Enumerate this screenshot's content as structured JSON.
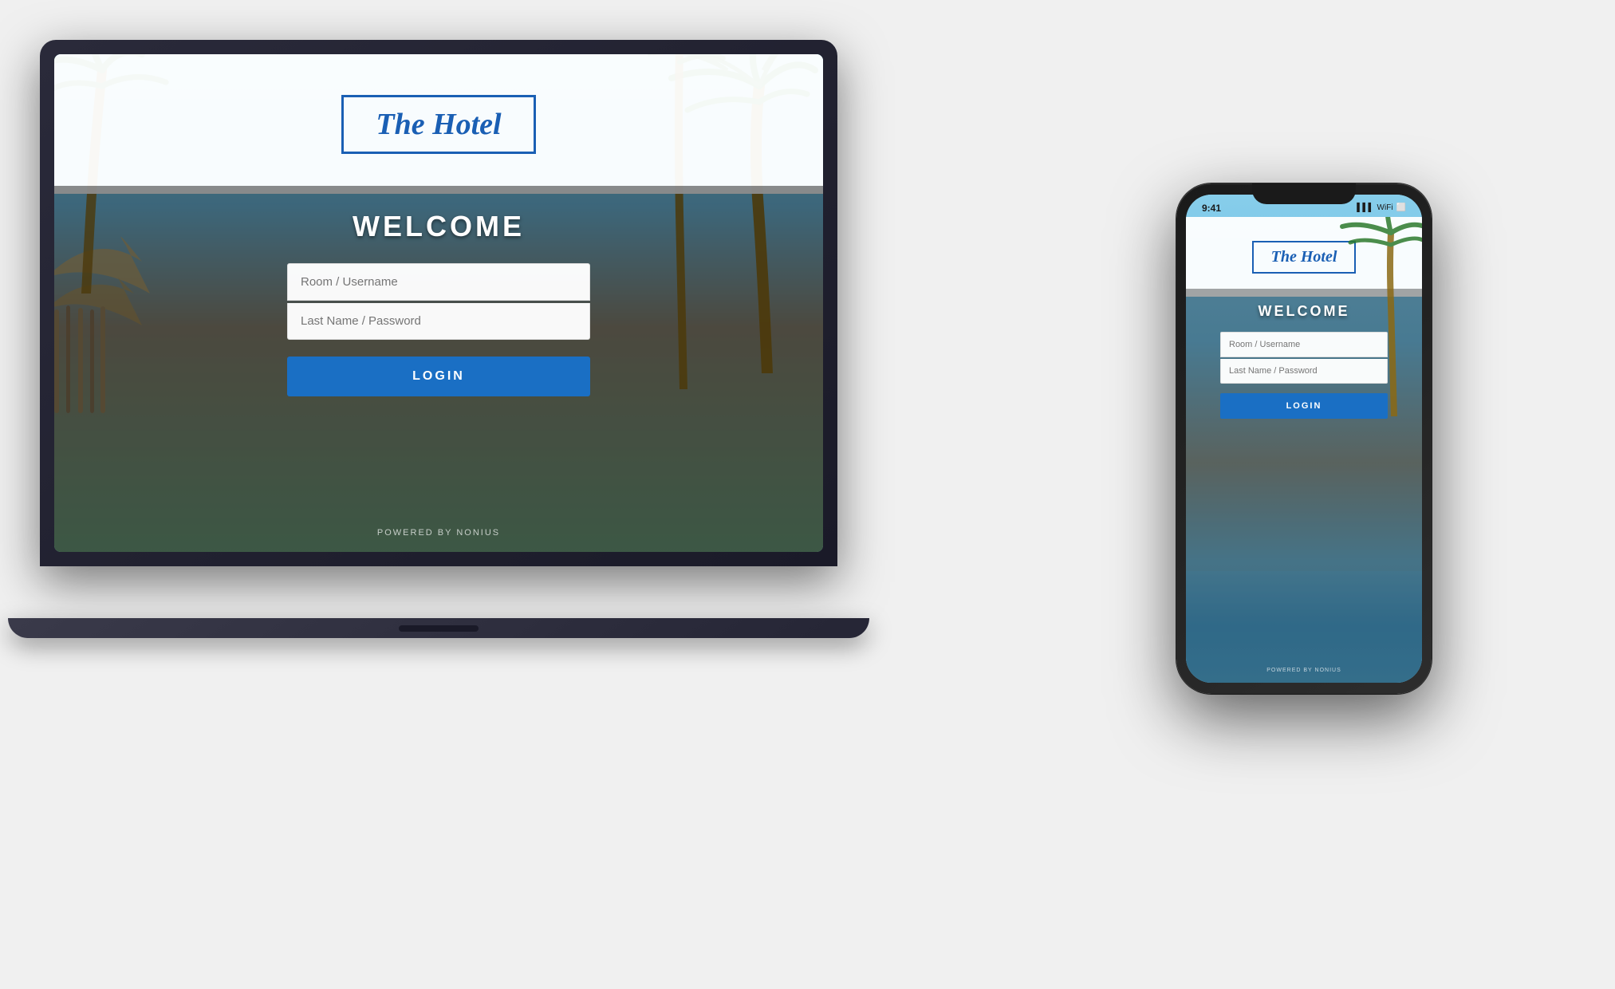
{
  "laptop": {
    "hotel_logo": "The Hotel",
    "welcome_text": "WELCOME",
    "input_room_placeholder": "Room / Username",
    "input_password_placeholder": "Last Name / Password",
    "login_button": "LOGIN",
    "powered_by": "POWERED BY NONIUS"
  },
  "phone": {
    "status_time": "9:41",
    "status_signal": "▌▌▌",
    "status_wifi": "WiFi",
    "status_battery": "🔋",
    "hotel_logo": "The Hotel",
    "welcome_text": "WELCOME",
    "input_room_placeholder": "Room / Username",
    "input_password_placeholder": "Last Name / Password",
    "login_button": "LOGIN",
    "powered_by": "POWERED BY NONIUS"
  },
  "colors": {
    "brand_blue": "#1a5fb4",
    "button_blue": "#1a6fc4",
    "white": "#ffffff"
  }
}
